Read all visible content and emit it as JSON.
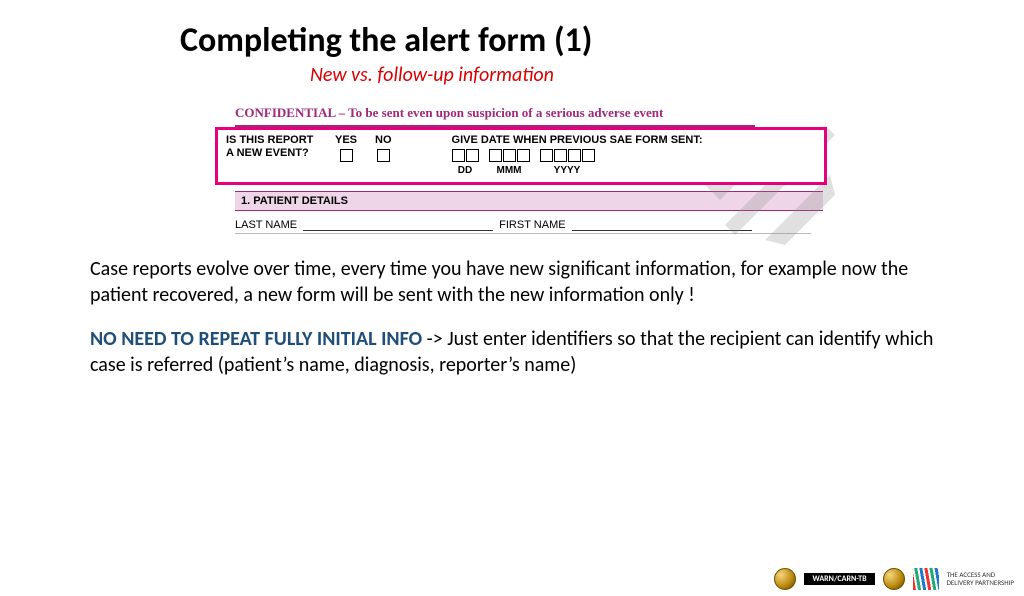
{
  "title": "Completing the alert form (1)",
  "subtitle": "New vs. follow-up information",
  "form": {
    "confidential": "CONFIDENTIAL – To be sent even upon suspicion of a serious adverse event",
    "question_line1": "IS THIS REPORT",
    "question_line2": "A NEW EVENT?",
    "yes": "YES",
    "no": "NO",
    "date_label": "GIVE DATE WHEN PREVIOUS SAE FORM SENT:",
    "dd": "DD",
    "mmm": "MMM",
    "yyyy": "YYYY",
    "section1": "1. PATIENT DETAILS",
    "last_name": "LAST NAME",
    "first_name": "FIRST NAME"
  },
  "para1": "Case reports evolve over time, every time you have new significant information, for example now the patient recovered, a new form will be sent with the new information only !",
  "emph": "NO NEED TO REPEAT FULLY INITIAL INFO",
  "para2_rest": " ->  Just enter identifiers so that the recipient can identify which case is referred (patient’s name, diagnosis, reporter’s name)",
  "footer": {
    "warn": "WARN/CARN-TB",
    "partner1": "THE ACCESS AND",
    "partner2": "DELIVERY PARTNERSHIP"
  }
}
